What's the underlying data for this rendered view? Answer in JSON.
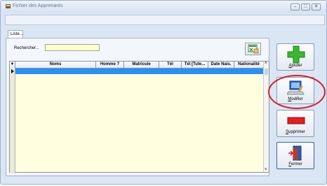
{
  "window": {
    "title": "Fichier des Apprenants",
    "controls": [
      "–",
      "□",
      "✕"
    ]
  },
  "tabs": [
    {
      "label": "Liste..."
    }
  ],
  "search": {
    "label": "Rechercher...",
    "value": ""
  },
  "grid": {
    "columns": [
      "Noms",
      "Homme ?",
      "Matricule",
      "Tél",
      "Tél [Tute...",
      "Date Nais.",
      "Nationalité"
    ],
    "rows": []
  },
  "buttons": {
    "add": {
      "label": "Ajouter",
      "icon": "plus-icon"
    },
    "edit": {
      "label": "Modifier",
      "icon": "computer-edit-icon"
    },
    "delete": {
      "label": "Supprimer",
      "icon": "red-bar-icon"
    },
    "close": {
      "label": "Fermer",
      "icon": "door-exit-icon"
    }
  },
  "colors": {
    "highlight": "#d01f2a",
    "selection": "#2b8ef0",
    "grid_bg": "#ffffe0",
    "add_icon": "#3cb731"
  }
}
